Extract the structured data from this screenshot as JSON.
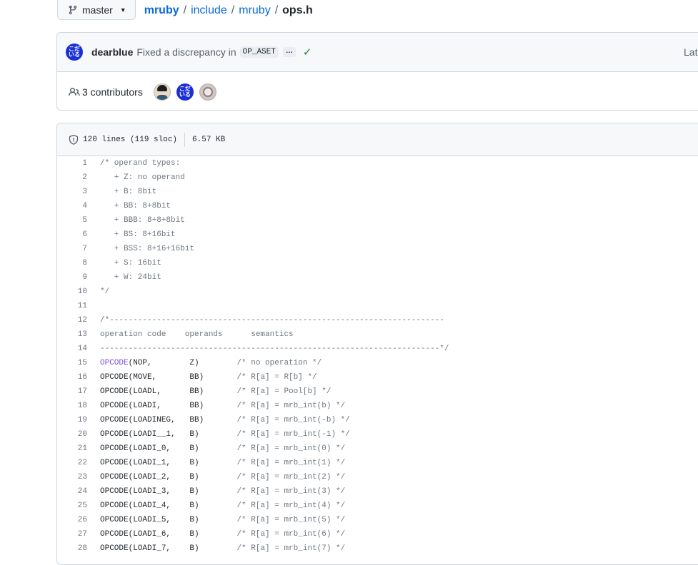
{
  "branch": {
    "label": "master"
  },
  "breadcrumb": {
    "repo": "mruby",
    "sep": "/",
    "dir1": "include",
    "dir2": "mruby",
    "file": "ops.h"
  },
  "commit": {
    "author": "dearblue",
    "message": "Fixed a discrepancy in",
    "code": "OP_ASET",
    "ellipsis": "…",
    "latest": "Late"
  },
  "contributors": {
    "label": "3 contributors"
  },
  "file_info": {
    "lines": "120 lines (119 sloc)",
    "size": "6.57 KB"
  },
  "code_lines": [
    {
      "num": "1",
      "text": "/* operand types:"
    },
    {
      "num": "2",
      "text": "   + Z: no operand"
    },
    {
      "num": "3",
      "text": "   + B: 8bit"
    },
    {
      "num": "4",
      "text": "   + BB: 8+8bit"
    },
    {
      "num": "5",
      "text": "   + BBB: 8+8+8bit"
    },
    {
      "num": "6",
      "text": "   + BS: 8+16bit"
    },
    {
      "num": "7",
      "text": "   + BSS: 8+16+16bit"
    },
    {
      "num": "8",
      "text": "   + S: 16bit"
    },
    {
      "num": "9",
      "text": "   + W: 24bit"
    },
    {
      "num": "10",
      "text": "*/"
    },
    {
      "num": "11",
      "text": ""
    },
    {
      "num": "12",
      "text": "/*-----------------------------------------------------------------------"
    },
    {
      "num": "13",
      "text": "operation code    operands      semantics"
    },
    {
      "num": "14",
      "text": "------------------------------------------------------------------------*/"
    },
    {
      "num": "15",
      "text": "(NOP,        Z)        ",
      "fn": "OPCODE",
      "comment": "/* no operation */"
    },
    {
      "num": "16",
      "text": "(MOVE,       BB)       ",
      "fn": "OPCODE",
      "comment": "/* R[a] = R[b] */"
    },
    {
      "num": "17",
      "text": "(LOADL,      BB)       ",
      "fn": "OPCODE",
      "comment": "/* R[a] = Pool[b] */"
    },
    {
      "num": "18",
      "text": "(LOADI,      BB)       ",
      "fn": "OPCODE",
      "comment": "/* R[a] = mrb_int(b) */"
    },
    {
      "num": "19",
      "text": "(LOADINEG,   BB)       ",
      "fn": "OPCODE",
      "comment": "/* R[a] = mrb_int(-b) */"
    },
    {
      "num": "20",
      "text": "(LOADI__1,   B)        ",
      "fn": "OPCODE",
      "comment": "/* R[a] = mrb_int(-1) */"
    },
    {
      "num": "21",
      "text": "(LOADI_0,    B)        ",
      "fn": "OPCODE",
      "comment": "/* R[a] = mrb_int(0) */"
    },
    {
      "num": "22",
      "text": "(LOADI_1,    B)        ",
      "fn": "OPCODE",
      "comment": "/* R[a] = mrb_int(1) */"
    },
    {
      "num": "23",
      "text": "(LOADI_2,    B)        ",
      "fn": "OPCODE",
      "comment": "/* R[a] = mrb_int(2) */"
    },
    {
      "num": "24",
      "text": "(LOADI_3,    B)        ",
      "fn": "OPCODE",
      "comment": "/* R[a] = mrb_int(3) */"
    },
    {
      "num": "25",
      "text": "(LOADI_4,    B)        ",
      "fn": "OPCODE",
      "comment": "/* R[a] = mrb_int(4) */"
    },
    {
      "num": "26",
      "text": "(LOADI_5,    B)        ",
      "fn": "OPCODE",
      "comment": "/* R[a] = mrb_int(5) */"
    },
    {
      "num": "27",
      "text": "(LOADI_6,    B)        ",
      "fn": "OPCODE",
      "comment": "/* R[a] = mrb_int(6) */"
    },
    {
      "num": "28",
      "text": "(LOADI_7,    B)        ",
      "fn": "OPCODE",
      "comment": "/* R[a] = mrb_int(7) */"
    }
  ],
  "colors": {
    "link": "#0969da",
    "keyword": "#8250df",
    "comment": "#6e7781",
    "success": "#1a7f37",
    "border": "#d0d7de"
  }
}
